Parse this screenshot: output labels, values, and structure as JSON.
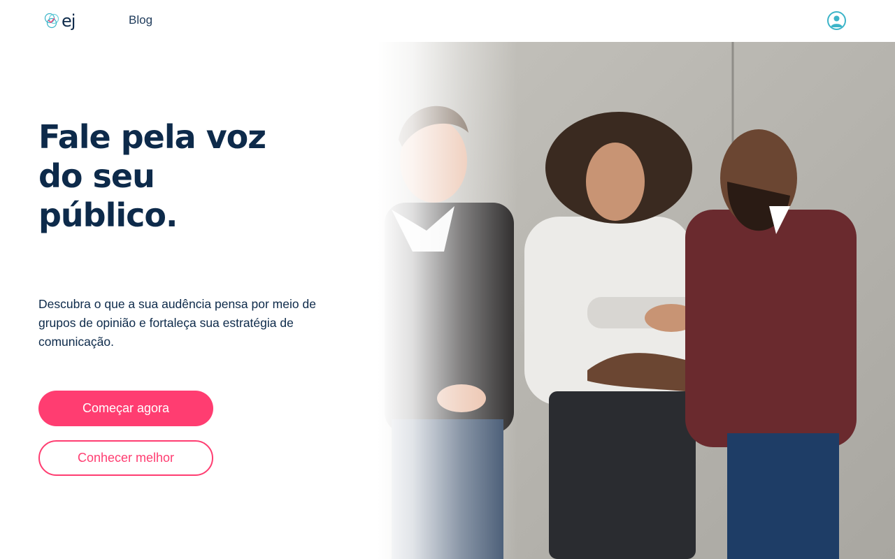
{
  "header": {
    "logo_text": "ej",
    "nav_blog": "Blog",
    "user_icon": "user-circle-icon"
  },
  "hero": {
    "headline_lines": [
      "Fale pela voz",
      "do seu",
      "público."
    ],
    "description": "Descubra o que a sua audência pensa por meio de grupos de opinião e fortaleça sua estratégia de comunicação.",
    "primary_button": "Começar agora",
    "secondary_button": "Conhecer melhor"
  },
  "colors": {
    "brand_pink": "#ff3d71",
    "brand_navy": "#0d2a4a",
    "brand_teal": "#3cb4c8"
  }
}
